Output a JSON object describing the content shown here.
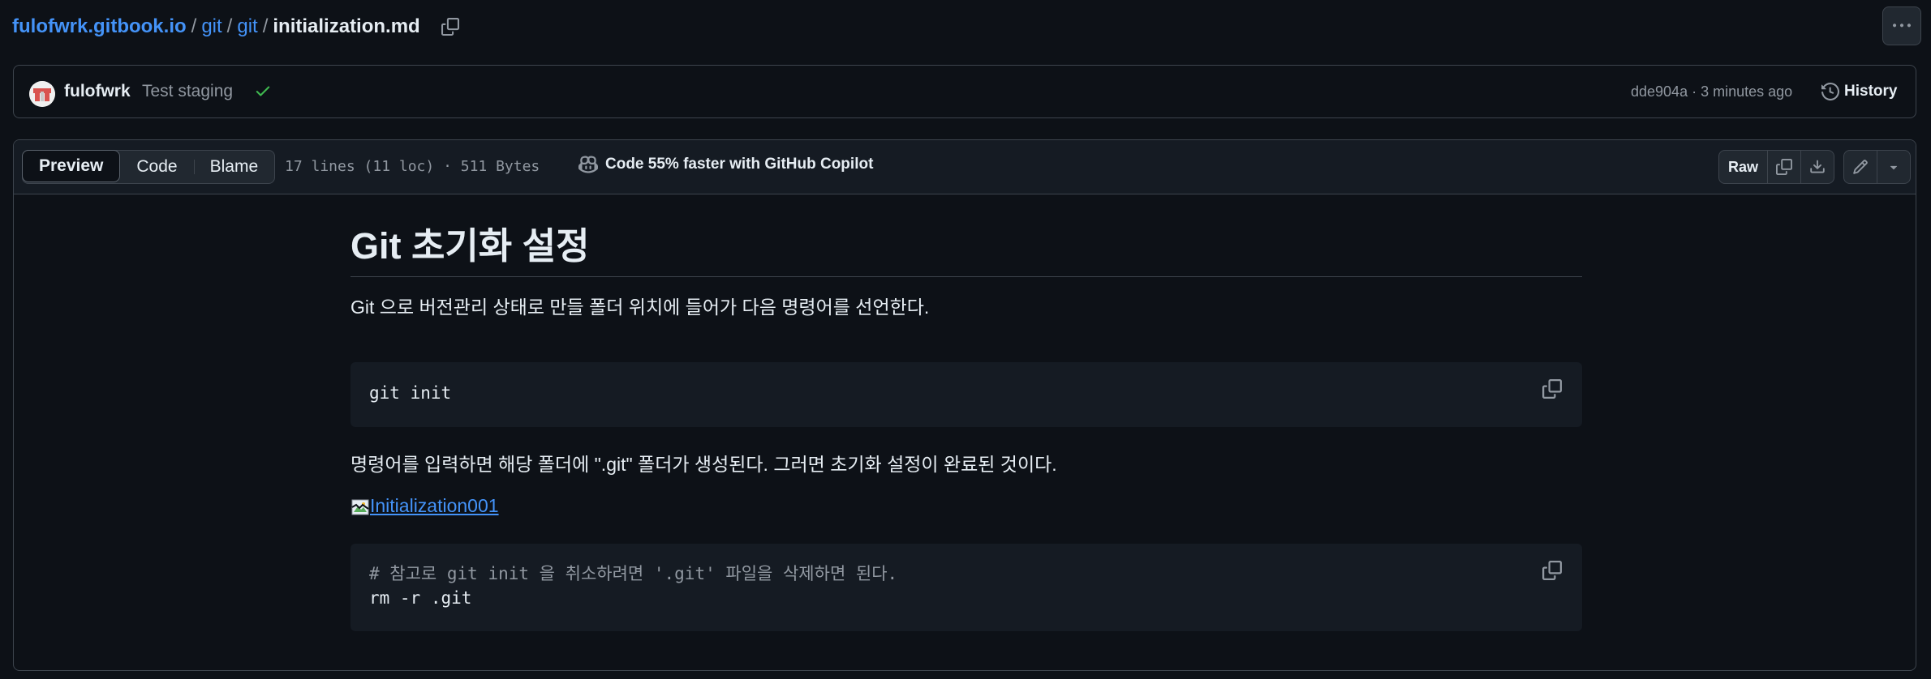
{
  "breadcrumb": {
    "repo": "fulofwrk.gitbook.io",
    "path1": "git",
    "path2": "git",
    "file": "initialization.md",
    "separator": "/"
  },
  "commit": {
    "author": "fulofwrk",
    "message": "Test staging",
    "meta": "dde904a · 3 minutes ago",
    "history_label": "History"
  },
  "file_header": {
    "tabs": [
      "Preview",
      "Code",
      "Blame"
    ],
    "active_tab": "Preview",
    "info": "17 lines (11 loc) · 511 Bytes",
    "copilot": "Code 55% faster with GitHub Copilot",
    "raw_label": "Raw"
  },
  "content": {
    "heading": "Git 초기화 설정",
    "p1": "Git 으로 버전관리 상태로 만들 폴더 위치에 들어가 다음 명령어를 선언한다.",
    "code1": "git init",
    "p2": "명령어를 입력하면 해당 폴더에 \".git\" 폴더가 생성된다. 그러면 초기화 설정이 완료된 것이다.",
    "image_alt": "Initialization001",
    "code2_comment": "# 참고로 git init 을 취소하려면 '.git' 파일을 삭제하면 된다.",
    "code2_cmd": "rm -r .git"
  },
  "icons": {
    "copy": "copy-icon",
    "kebab": "kebab-horizontal-icon",
    "check": "check-icon",
    "history": "history-icon",
    "copilot": "copilot-icon",
    "download": "download-icon",
    "pencil": "pencil-icon",
    "triangle": "triangle-down-icon",
    "broken_image": "broken-image-icon"
  },
  "colors": {
    "background": "#0d1117",
    "link": "#4493f8",
    "muted": "#9198a1",
    "success": "#3fb950",
    "border": "#3d444d"
  }
}
